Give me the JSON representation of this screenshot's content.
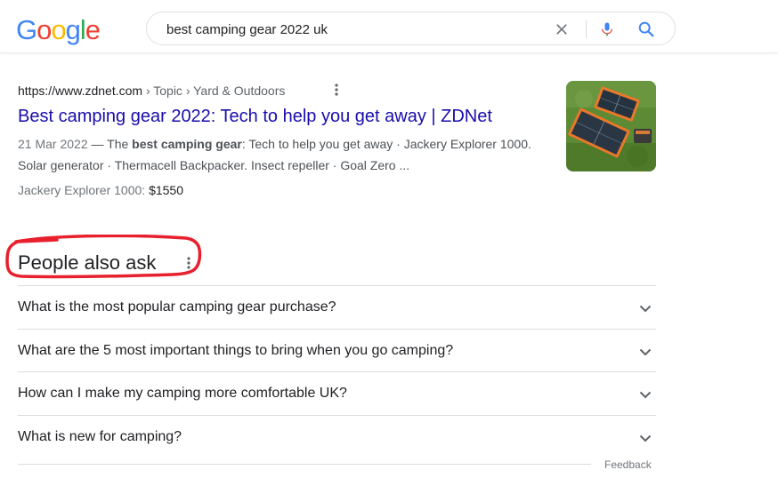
{
  "logo": {
    "letters": [
      {
        "ch": "G",
        "color": "#4285F4"
      },
      {
        "ch": "o",
        "color": "#EA4335"
      },
      {
        "ch": "o",
        "color": "#FBBC05"
      },
      {
        "ch": "g",
        "color": "#4285F4"
      },
      {
        "ch": "l",
        "color": "#34A853"
      },
      {
        "ch": "e",
        "color": "#EA4335"
      }
    ]
  },
  "search": {
    "query": "best camping gear 2022 uk",
    "icons": {
      "clear": "close-icon",
      "voice": "microphone-icon",
      "submit": "search-icon"
    }
  },
  "result": {
    "domain": "https://www.zdnet.com",
    "breadcrumb": " › Topic › Yard & Outdoors",
    "title": "Best camping gear 2022: Tech to help you get away | ZDNet",
    "date": "21 Mar 2022",
    "snippet_pre": " — The ",
    "snippet_bold": "best camping gear",
    "snippet_post": ": Tech to help you get away · Jackery Explorer 1000. Solar generator · Thermacell Backpacker. Insect repeller · Goal Zero ...",
    "price_label": "Jackery Explorer 1000: ",
    "price_value": "$1550",
    "thumbnail": "solar-panels-on-grass-image"
  },
  "people_also_ask": {
    "heading": "People also ask",
    "questions": [
      "What is the most popular camping gear purchase?",
      "What are the 5 most important things to bring when you go camping?",
      "How can I make my camping more comfortable UK?",
      "What is new for camping?"
    ]
  },
  "feedback_label": "Feedback",
  "colors": {
    "link": "#1a0dab",
    "annotation_circle": "#e8202e",
    "mic_blue": "#4285F4",
    "mic_red": "#EA4335"
  }
}
